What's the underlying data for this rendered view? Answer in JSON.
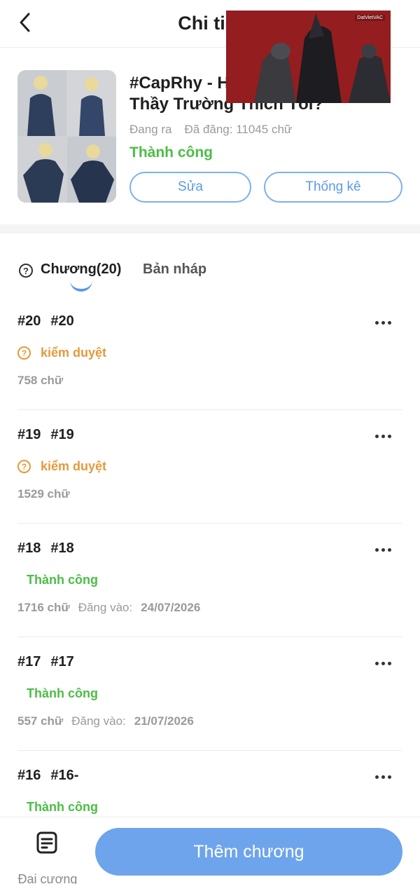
{
  "header": {
    "title": "Chi tiết",
    "back_icon": "chevron-left-icon"
  },
  "video_overlay": {
    "channel_tag": "DatVietVAC"
  },
  "story": {
    "title": "#CapRhy - Hôm Nay Có Phải Là Thầy Trường Thích Tôi?",
    "publish_state": "Đang ra",
    "word_count": "Đã đăng: 11045 chữ",
    "status": "Thành công",
    "edit_label": "Sửa",
    "stats_label": "Thống kê"
  },
  "tabs": {
    "chapters_label": "Chương(20)",
    "drafts_label": "Bản nháp"
  },
  "chapters": [
    {
      "number": "#20",
      "name": "#20",
      "status": "kiểm duyệt",
      "words": "758 chữ",
      "date_label": "",
      "date": ""
    },
    {
      "number": "#19",
      "name": "#19",
      "status": "kiểm duyệt",
      "words": "1529 chữ",
      "date_label": "",
      "date": ""
    },
    {
      "number": "#18",
      "name": "#18",
      "status": "Thành công",
      "words": "1716 chữ",
      "date_label": "Đăng vào:",
      "date": "24/07/2026"
    },
    {
      "number": "#17",
      "name": "#17",
      "status": "Thành công",
      "words": "557 chữ",
      "date_label": "Đăng vào:",
      "date": "21/07/2026"
    },
    {
      "number": "#16",
      "name": "#16-",
      "status": "Thành công",
      "words": "",
      "date_label": "",
      "date": ""
    }
  ],
  "bottom_bar": {
    "outline_label": "Đại cương",
    "outline_icon": "document-icon",
    "add_chapter_label": "Thêm chương"
  },
  "colors": {
    "accent": "#6ea4ec",
    "success": "#4cbd46",
    "review": "#e59a3c"
  }
}
